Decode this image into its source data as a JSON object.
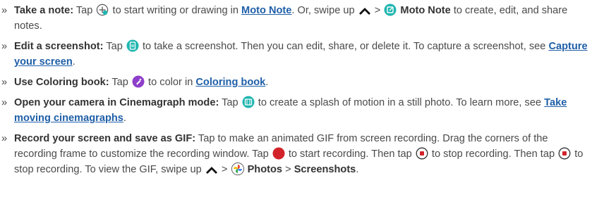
{
  "bullet": "»",
  "items": [
    {
      "title": "Take a note:",
      "t1": "Tap",
      "t2": "to start writing or drawing in",
      "link": "Moto Note",
      "t3": ". Or, swipe up",
      "t4": ">",
      "bold2": "Moto Note",
      "t5": "to create, edit, and share notes."
    },
    {
      "title": "Edit a screenshot:",
      "t1": "Tap",
      "t2": "to take a screenshot. Then you can edit, share, or delete it. To capture a screenshot, see",
      "link": "Capture your screen",
      "t3": "."
    },
    {
      "title": "Use Coloring book:",
      "t1": "Tap",
      "t2": "to color in",
      "link": "Coloring book",
      "t3": "."
    },
    {
      "title": "Open your camera in Cinemagraph mode:",
      "t1": "Tap",
      "t2": "to create a splash of motion in a still photo. To learn more, see",
      "link": "Take moving cinemagraphs",
      "t3": "."
    },
    {
      "title": "Record your screen and save as GIF:",
      "t1": "Tap to make an animated GIF from screen recording. Drag the corners of the recording frame to customize the recording window. Tap",
      "t2": "to start recording. Then tap",
      "t3": "to stop recording. Then tap",
      "t4": "to stop recording. To view the GIF, swipe up",
      "t5": ">",
      "bold2": "Photos",
      "t6": ">",
      "bold3": "Screenshots",
      "t7": "."
    }
  ],
  "colors": {
    "link": "#1f5fa8",
    "text": "#4a4a4a",
    "teal": "#1fb5b0",
    "purple": "#8e3fc9",
    "red": "#d2232a"
  },
  "icons": [
    "add-note-icon",
    "chevron-up-icon",
    "moto-note-app-icon",
    "screenshot-icon",
    "coloring-book-icon",
    "cinemagraph-icon",
    "record-icon",
    "stop-icon",
    "google-photos-icon"
  ]
}
